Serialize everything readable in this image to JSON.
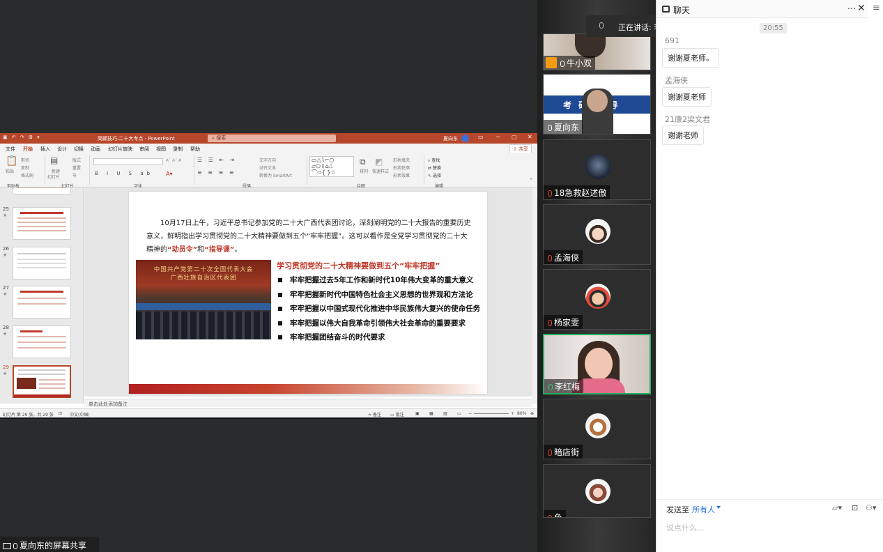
{
  "share": {
    "footer_label": "夏向东的屏幕共享",
    "ppt": {
      "window_title": "简顯技巧:二十大专点 - PowerPoint",
      "search_placeholder": "搜索",
      "user_name": "夏向东",
      "menu_tabs": [
        "文件",
        "开始",
        "插入",
        "设计",
        "切换",
        "动画",
        "幻灯片放映",
        "审阅",
        "视图",
        "录制",
        "帮助"
      ],
      "active_tab": "开始",
      "share_label": "共享",
      "ribbon": {
        "paste": "粘贴",
        "cut": "剪切",
        "copy": "复制",
        "format_painter": "格式刷",
        "new_slide": "新建",
        "new_slide2": "幻灯片",
        "layout": "版式",
        "reset": "重置",
        "section": "节",
        "text_direction": "文字方向",
        "align_text": "对齐文本",
        "smartart": "转换为 SmartArt",
        "arrange": "排列",
        "quick_styles": "快速样式",
        "shape_fill": "形状填充",
        "shape_outline": "形状轮廓",
        "shape_effects": "形状效果",
        "find": "查找",
        "replace": "替换",
        "select": "选择",
        "groups": [
          "剪贴板",
          "幻灯片",
          "字体",
          "段落",
          "绘图",
          "编辑"
        ]
      },
      "thumbnails": [
        {
          "num": "25",
          "star": "★"
        },
        {
          "num": "26",
          "star": "★"
        },
        {
          "num": "27",
          "star": "★"
        },
        {
          "num": "28",
          "star": "★"
        },
        {
          "num": "29",
          "star": "★"
        }
      ],
      "slide": {
        "intro_before": "10月17日上午，习近平总书记参加党的二十大广西代表团讨论，深刻阐明党的二十大报告的重要历史意义，鲜明指出学习贯彻党的二十大精神要做到五个“牢牢把握”。这可以看作是全党学习贯彻党的二十大精神的",
        "intro_hl1": "“动员令”",
        "intro_and": "和",
        "intro_hl2": "“指导课”",
        "intro_end": "。",
        "photo_banner_line1": "中国共产党第二十次全国代表大会",
        "photo_banner_line2": "广西壮族自治区代表团",
        "heading": "学习贯彻党的二十大精神要做到五个“牢牢把握”",
        "bullets": [
          "牢牢把握过去5年工作和新时代10年伟大变革的重大意义",
          "牢牢把握新时代中国特色社会主义思想的世界观和方法论",
          "牢牢把握以中国式现代化推进中华民族伟大复兴的使命任务",
          "牢牢把握以伟大自我革命引领伟大社会革命的重要要求",
          "牢牢把握团结奋斗的时代要求"
        ]
      },
      "notes_placeholder": "单击此处添加备注",
      "status": {
        "slide_info": "幻灯片 第 29 张，共 29 张",
        "language": "中文(中国)",
        "notes": "备注",
        "comments": "批注",
        "zoom": "80%"
      }
    }
  },
  "speaking": {
    "text": "正在讲话: 李红梅;"
  },
  "participants": [
    {
      "name": "牛小双",
      "type": "camera",
      "muted": false
    },
    {
      "name": "夏向东",
      "type": "camera",
      "muted": false,
      "backdrop_title": "考 研 辅 导"
    },
    {
      "name": "18急救赵述傲",
      "type": "avatar",
      "muted": true
    },
    {
      "name": "孟海侠",
      "type": "avatar",
      "muted": true
    },
    {
      "name": "杨家雯",
      "type": "avatar",
      "muted": true
    },
    {
      "name": "李红梅",
      "type": "camera",
      "muted": false,
      "speaking": true
    },
    {
      "name": "暗店街",
      "type": "avatar",
      "muted": true
    },
    {
      "name": "鱼",
      "type": "avatar",
      "muted": true
    }
  ],
  "chat": {
    "title": "聊天",
    "time": "20:55",
    "messages": [
      {
        "sender": "691",
        "text": "谢谢夏老师。"
      },
      {
        "sender": "孟海侠",
        "text": "谢谢夏老师"
      },
      {
        "sender": "21康2梁文君",
        "text": "谢谢老师"
      }
    ],
    "send_to_label": "发送至",
    "send_to_target": "所有人",
    "input_placeholder": "说点什么..."
  },
  "colors": {
    "ppt_accent": "#b7472a",
    "slide_red": "#c0392b",
    "speaking_border": "#27ae60",
    "chat_link": "#1e6fd9"
  }
}
